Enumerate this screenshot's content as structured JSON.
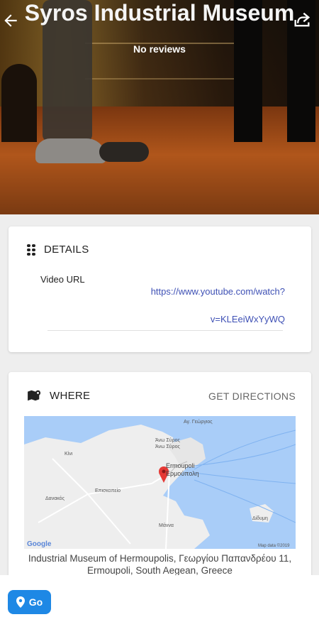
{
  "header": {
    "title": "Syros Industrial Museum",
    "reviews": "No reviews"
  },
  "icons": {
    "back": "arrow-left",
    "share": "share-arrow",
    "details": "grid-dots",
    "where": "map-marker",
    "go": "location-pin"
  },
  "details": {
    "heading": "DETAILS",
    "video_label": "Video URL",
    "video_url_line1": "https://www.youtube.com/watch?",
    "video_url_line2": "v=KLEeiWxYyWQ"
  },
  "where": {
    "heading": "WHERE",
    "directions_label": "GET DIRECTIONS",
    "address": "Industrial Museum of Hermoupolis, Γεωργίου Παπανδρέου 11, Ermoupoli, South Aegean, Greece",
    "map_labels": {
      "ag_georgios": "Αγ. Γεώργιος",
      "kini": "Κίνι",
      "ano_syros": "Άνω Σύρος",
      "ano_syros_gr": "Άνω Σύρος",
      "ermoupoli": "Ermoupoli",
      "ermoupoli_gr": "Ερμούπολη",
      "episkopeio": "Επισκοπείο",
      "danakos": "Δανακός",
      "manna": "Μάννα",
      "didimi": "Δίδυμη",
      "google": "Google",
      "map_data": "Map data ©2019"
    }
  },
  "bottom": {
    "go_label": "Go"
  },
  "colors": {
    "accent": "#1e88e5",
    "link": "#3f51b5",
    "marker": "#e53935"
  }
}
